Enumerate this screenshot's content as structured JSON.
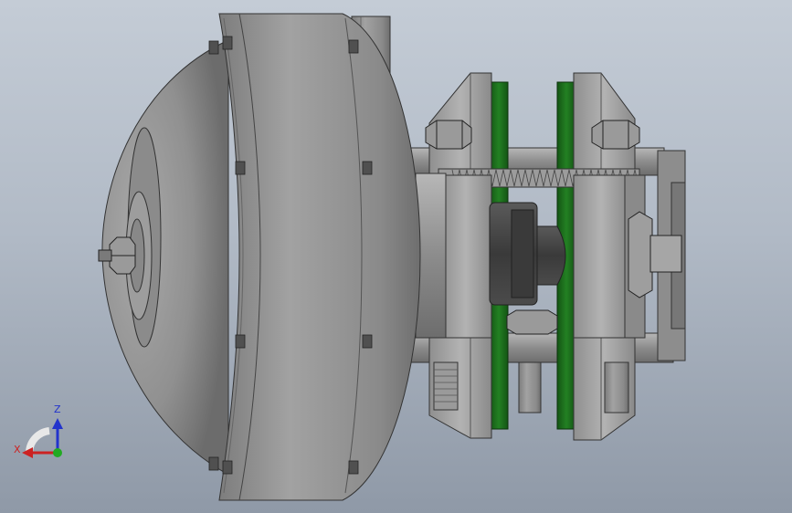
{
  "axes": {
    "z_label": "Z",
    "x_label": "X"
  },
  "colors": {
    "body": "#8e8e8e",
    "green_plate": "#1c6a1c",
    "axis_x": "#cc2222",
    "axis_y": "#22aa22",
    "axis_z": "#2233cc"
  }
}
